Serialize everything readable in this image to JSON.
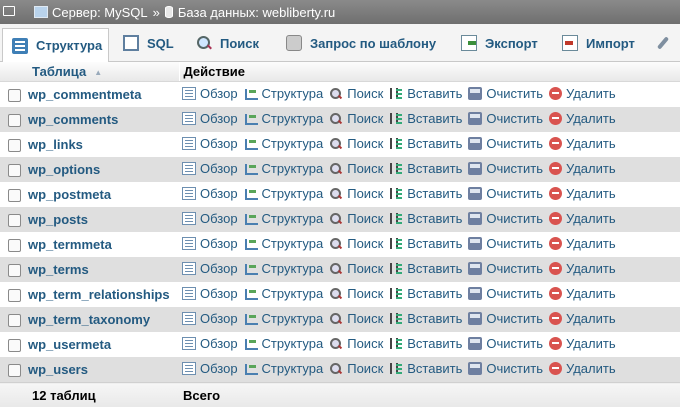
{
  "breadcrumb": {
    "server_label": "Сервер: MySQL",
    "separator": "»",
    "database_label": "База данных: webliberty.ru"
  },
  "tabs": [
    {
      "label": "Структура",
      "icon": "structure-icon",
      "active": true
    },
    {
      "label": "SQL",
      "icon": "sql-icon",
      "active": false
    },
    {
      "label": "Поиск",
      "icon": "search-icon",
      "active": false
    },
    {
      "label": "Запрос по шаблону",
      "icon": "query-icon",
      "active": false
    },
    {
      "label": "Экспорт",
      "icon": "export-icon",
      "active": false
    },
    {
      "label": "Импорт",
      "icon": "import-icon",
      "active": false
    }
  ],
  "table": {
    "headers": {
      "name": "Таблица",
      "action": "Действие"
    },
    "actions": [
      "Обзор",
      "Структура",
      "Поиск",
      "Вставить",
      "Очистить",
      "Удалить"
    ],
    "rows": [
      "wp_commentmeta",
      "wp_comments",
      "wp_links",
      "wp_options",
      "wp_postmeta",
      "wp_posts",
      "wp_termmeta",
      "wp_terms",
      "wp_term_relationships",
      "wp_term_taxonomy",
      "wp_usermeta",
      "wp_users"
    ],
    "footer": {
      "count": "12 таблиц",
      "total": "Всего"
    }
  }
}
